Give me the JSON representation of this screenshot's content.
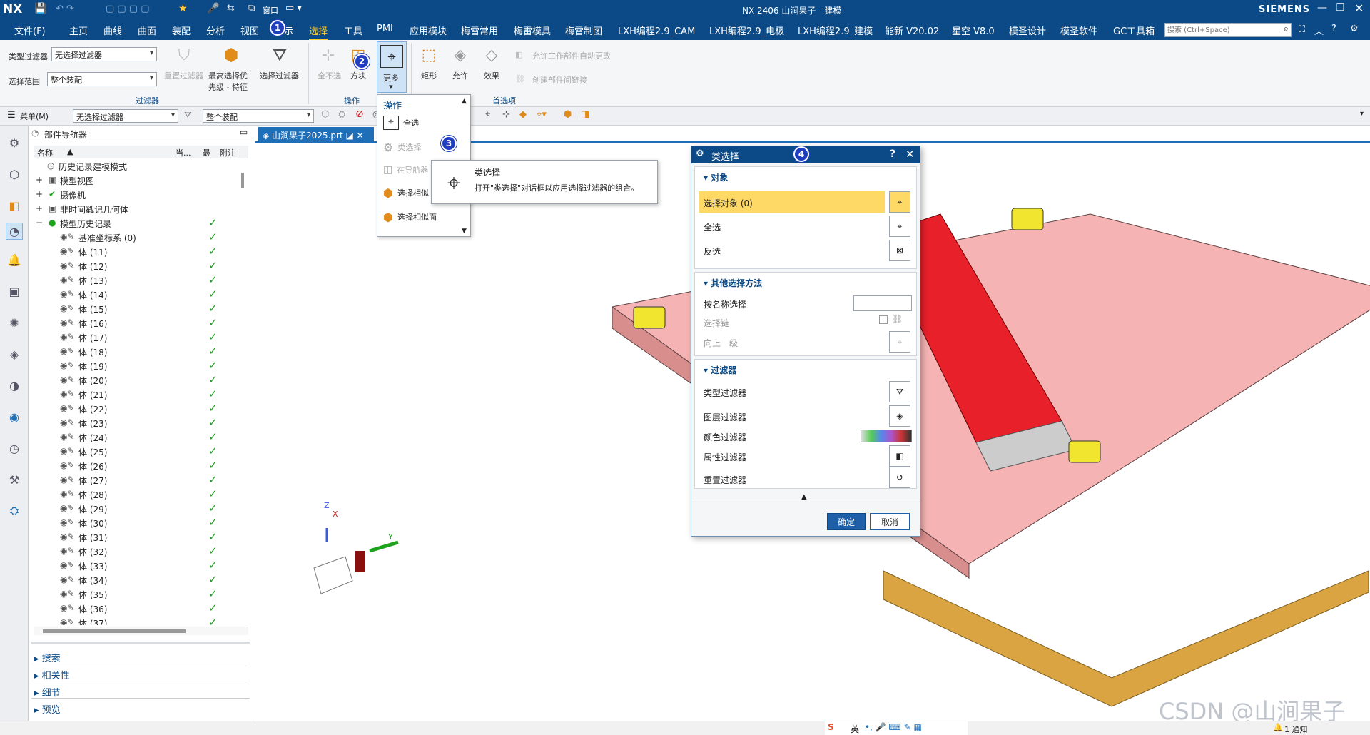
{
  "titlebar": {
    "logo": "NX",
    "window_menu": "窗口",
    "title": "NX 2406 山涧果子 - 建模",
    "brand": "SIEMENS"
  },
  "menubar": {
    "items": [
      "文件(F)",
      "主页",
      "曲线",
      "曲面",
      "装配",
      "分析",
      "视图",
      "示",
      "选择",
      "工具",
      "PMI",
      "应用模块",
      "梅雷常用",
      "梅雷模具",
      "梅雷制图",
      "LXH编程2.9_CAM",
      "LXH编程2.9_电极",
      "LXH编程2.9_建模",
      "能新 V20.02",
      "星空 V8.0",
      "模圣设计",
      "模圣软件",
      "GC工具箱"
    ],
    "search_placeholder": "搜索 (Ctrl+Space)",
    "active_color": "#ffcc33"
  },
  "ribbon": {
    "type_filter_label": "类型过滤器",
    "type_filter_value": "无选择过滤器",
    "scope_label": "选择范围",
    "scope_value": "整个装配",
    "reset_filter": "重置过滤器",
    "priority_line1": "最高选择优",
    "priority_line2": "先级 - 特征",
    "select_filter": "选择过滤器",
    "group_filter": "过滤器",
    "deselect_all": "全不选",
    "block": "方块",
    "more": "更多",
    "group_ops": "操作",
    "rect": "矩形",
    "allow": "允许",
    "effect": "效果",
    "auto_update": "允许工作部件自动更改",
    "create_link": "创建部件间链接",
    "group_prefs": "首选项"
  },
  "toolbar2": {
    "menu_label": "菜单(M)",
    "filter_value": "无选择过滤器",
    "scope_value": "整个装配"
  },
  "dropdown": {
    "header": "操作",
    "items": [
      "全选",
      "类选择",
      "在导航器",
      "选择相似",
      "选择相似面"
    ]
  },
  "tooltip": {
    "title": "类选择",
    "desc": "打开\"类选择\"对话框以应用选择过滤器的组合。"
  },
  "navigator": {
    "title": "部件导航器",
    "col_name": "名称",
    "col_current": "当...",
    "col_latest": "最",
    "col_note": "附注",
    "rows": [
      "历史记录建模模式",
      "模型视图",
      "摄像机",
      "非时间戳记几何体",
      "模型历史记录",
      "基准坐标系 (0)",
      "体 (11)",
      "体 (12)",
      "体 (13)",
      "体 (14)",
      "体 (15)",
      "体 (16)",
      "体 (17)",
      "体 (18)",
      "体 (19)",
      "体 (20)",
      "体 (21)",
      "体 (22)",
      "体 (23)",
      "体 (24)",
      "体 (25)",
      "体 (26)",
      "体 (27)",
      "体 (28)",
      "体 (29)",
      "体 (30)",
      "体 (31)",
      "体 (32)",
      "体 (33)",
      "体 (34)",
      "体 (35)",
      "体 (36)",
      "体 (37)"
    ],
    "sections": [
      "搜索",
      "相关性",
      "细节",
      "预览"
    ]
  },
  "tab": {
    "label": "山涧果子2025.prt"
  },
  "dialog": {
    "title": "类选择",
    "sec_object": "对象",
    "select_object": "选择对象 (0)",
    "select_all": "全选",
    "invert": "反选",
    "sec_other": "其他选择方法",
    "by_name": "按名称选择",
    "chain": "选择链",
    "up_level": "向上一级",
    "sec_filter": "过滤器",
    "type_filter": "类型过滤器",
    "layer_filter": "图层过滤器",
    "color_filter": "颜色过滤器",
    "attr_filter": "属性过滤器",
    "reset_filter": "重置过滤器",
    "ok": "确定",
    "cancel": "取消",
    "highlight_color": "#ffd966"
  },
  "badges": [
    "1",
    "2",
    "3",
    "4"
  ],
  "status": {
    "ime": "英",
    "notify": "1 通知"
  },
  "watermark": "CSDN @山涧果子",
  "axes": {
    "x": "X",
    "y": "Y",
    "z": "Z"
  }
}
